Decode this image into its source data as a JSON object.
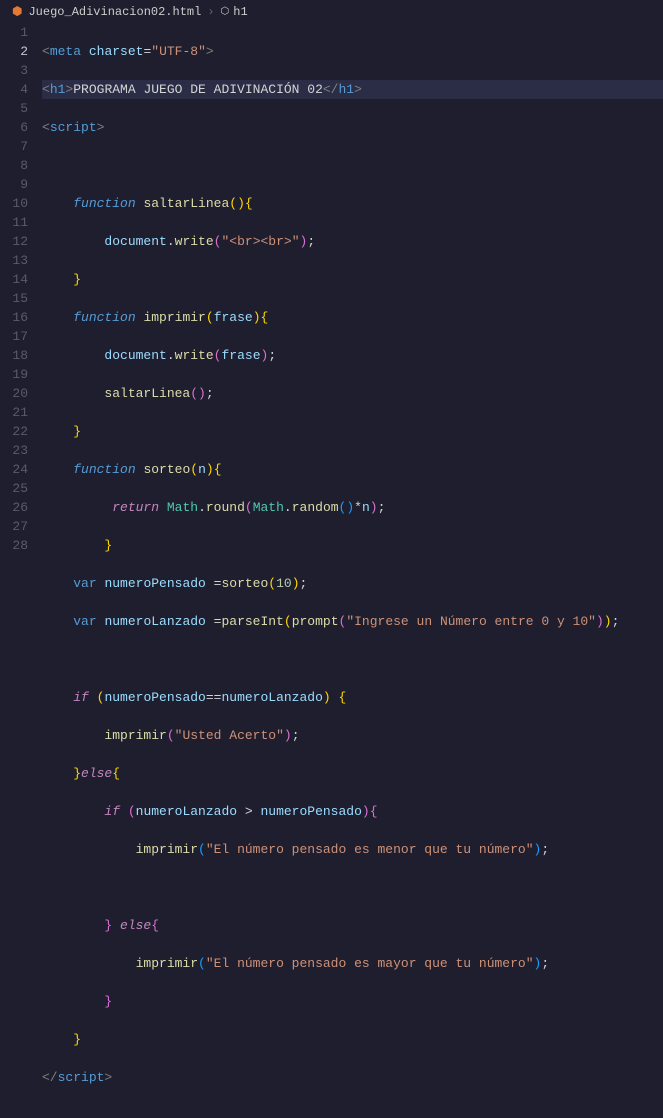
{
  "breadcrumb": {
    "file": "Juego_Adivinacion02.html",
    "separator": "›",
    "element_icon": "⬡",
    "element": "h1"
  },
  "gutter": {
    "lines": [
      "1",
      "2",
      "3",
      "4",
      "5",
      "6",
      "7",
      "8",
      "9",
      "10",
      "11",
      "12",
      "13",
      "14",
      "15",
      "16",
      "17",
      "18",
      "19",
      "20",
      "21",
      "22",
      "23",
      "24",
      "25",
      "26",
      "27",
      "28"
    ],
    "active": 2
  },
  "code": {
    "l1": {
      "t1": "<",
      "t2": "meta",
      "t3": " ",
      "t4": "charset",
      "t5": "=",
      "t6": "\"UTF-8\"",
      "t7": ">"
    },
    "l2": {
      "t1": "<",
      "t2": "h1",
      "t3": ">",
      "t4": "PROGRAMA JUEGO DE ADIVINACIÓN 02",
      "t5": "</",
      "t6": "h1",
      "t7": ">"
    },
    "l3": {
      "t1": "<",
      "t2": "script",
      "t3": ">"
    },
    "l4": "",
    "l5": {
      "t1": "    ",
      "t2": "function",
      "t3": " ",
      "t4": "saltarLinea",
      "t5": "()",
      "t6": "{"
    },
    "l6": {
      "t1": "        ",
      "t2": "document",
      "t3": ".",
      "t4": "write",
      "t5": "(",
      "t6": "\"<br><br>\"",
      "t7": ")",
      "t8": ";"
    },
    "l7": {
      "t1": "    ",
      "t2": "}"
    },
    "l8": {
      "t1": "    ",
      "t2": "function",
      "t3": " ",
      "t4": "imprimir",
      "t5": "(",
      "t6": "frase",
      "t7": ")",
      "t8": "{"
    },
    "l9": {
      "t1": "        ",
      "t2": "document",
      "t3": ".",
      "t4": "write",
      "t5": "(",
      "t6": "frase",
      "t7": ")",
      "t8": ";"
    },
    "l10": {
      "t1": "        ",
      "t2": "saltarLinea",
      "t3": "()",
      "t4": ";"
    },
    "l11": {
      "t1": "    ",
      "t2": "}"
    },
    "l12": {
      "t1": "    ",
      "t2": "function",
      "t3": " ",
      "t4": "sorteo",
      "t5": "(",
      "t6": "n",
      "t7": ")",
      " t8": " ",
      "t9": "{"
    },
    "l13": {
      "t1": "         ",
      "t2": "return",
      "t3": " ",
      "t4": "Math",
      "t5": ".",
      "t6": "round",
      "t7": "(",
      "t8": "Math",
      "t9": ".",
      "t10": "random",
      "t11": "()",
      "t12": "*",
      "t13": "n",
      "t14": ")",
      "t15": ";"
    },
    "l14": {
      "t1": "        ",
      "t2": "}"
    },
    "l15": {
      "t1": "    ",
      "t2": "var",
      "t3": " ",
      "t4": "numeroPensado",
      "t5": " =",
      "t6": "sorteo",
      "t7": "(",
      "t8": "10",
      "t9": ")",
      "t10": ";"
    },
    "l16": {
      "t1": "    ",
      "t2": "var",
      "t3": " ",
      "t4": "numeroLanzado",
      "t5": " =",
      "t6": "parseInt",
      "t7": "(",
      "t8": "prompt",
      "t9": "(",
      "t10": "\"Ingrese un Número entre 0 y 10\"",
      "t11": ")",
      "t12": ")",
      "t13": ";"
    },
    "l17": "",
    "l18": {
      "t1": "    ",
      "t2": "if",
      "t3": " (",
      "t4": "numeroPensado",
      "t5": "==",
      "t6": "numeroLanzado",
      "t7": ") {"
    },
    "l19": {
      "t1": "        ",
      "t2": "imprimir",
      "t3": "(",
      "t4": "\"Usted Acerto\"",
      "t5": ")",
      "t6": ";"
    },
    "l20": {
      "t1": "    }",
      "t2": "else",
      "t3": "{"
    },
    "l21": {
      "t1": "        ",
      "t2": "if",
      "t3": " (",
      "t4": "numeroLanzado",
      "t5": " > ",
      "t6": "numeroPensado",
      "t7": "){"
    },
    "l22": {
      "t1": "            ",
      "t2": "imprimir",
      "t3": "(",
      "t4": "\"El número pensado es menor que tu número\"",
      "t5": ")",
      "t6": ";"
    },
    "l23": "",
    "l24": {
      "t1": "        } ",
      "t2": "else",
      "t3": "{"
    },
    "l25": {
      "t1": "            ",
      "t2": "imprimir",
      "t3": "(",
      "t4": "\"El número pensado es mayor que tu número\"",
      "t5": ")",
      "t6": ";"
    },
    "l26": {
      "t1": "        }"
    },
    "l27": {
      "t1": "    }"
    },
    "l28": {
      "t1": "</",
      "t2": "script",
      "t3": ">"
    }
  }
}
